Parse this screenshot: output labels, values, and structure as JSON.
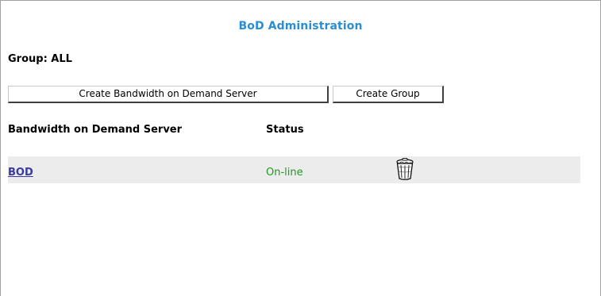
{
  "page": {
    "title": "BoD Administration"
  },
  "group": {
    "label": "Group: ALL"
  },
  "buttons": {
    "create_server": "Create Bandwidth on Demand Server",
    "create_group": "Create Group"
  },
  "table": {
    "headers": {
      "server": "Bandwidth on Demand Server",
      "status": "Status"
    },
    "rows": [
      {
        "server": "BOD",
        "status": "On-line",
        "action_icon": "trash-can-icon"
      }
    ]
  },
  "colors": {
    "title": "#2a8fd2",
    "link": "#3a3aa0",
    "status_online": "#1f9a1f",
    "row_background": "#ececec"
  }
}
